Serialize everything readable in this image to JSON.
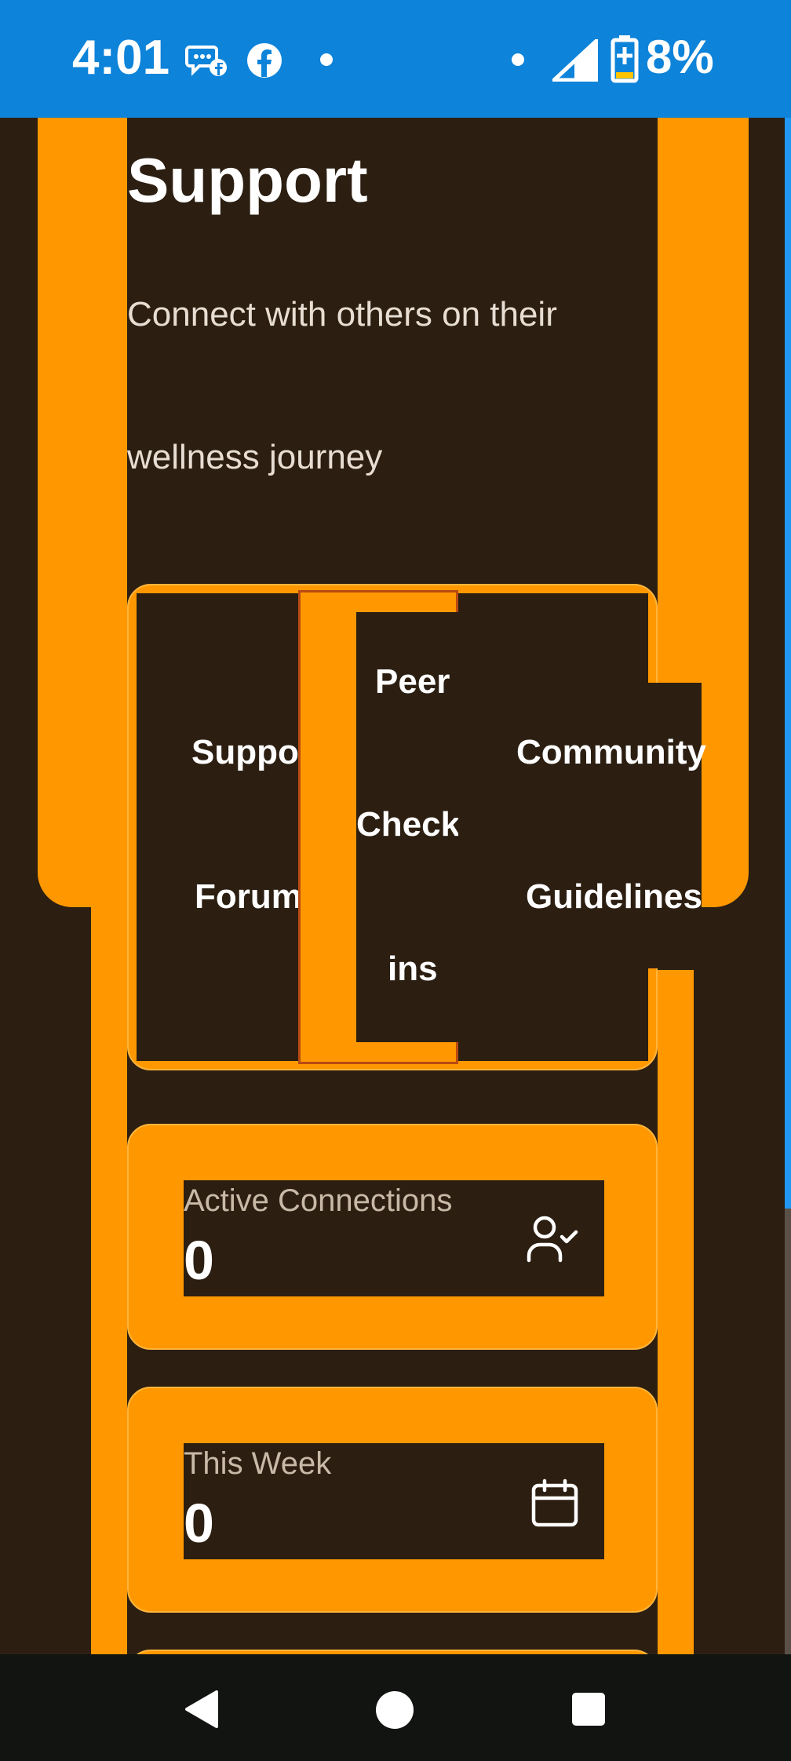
{
  "status_bar": {
    "time": "4:01",
    "battery": "8%",
    "icons": [
      "messenger-icon",
      "facebook-icon",
      "dot-icon",
      "signal-icon",
      "battery-charging-icon"
    ]
  },
  "header": {
    "title": "Support",
    "subtitle_line1": "Connect with others on their",
    "subtitle_line2": "wellness journey"
  },
  "tabs": {
    "support_forums": {
      "line1": "Suppor",
      "line2": "Forums"
    },
    "peer_checkins": {
      "line1": "Peer",
      "line2": "Check-",
      "line3": "ins"
    },
    "community_guidelines": {
      "line1": "Community",
      "line2": "Guidelines"
    }
  },
  "stats": [
    {
      "label": "Active Connections",
      "value": "0",
      "icon": "user-check-icon"
    },
    {
      "label": "This Week",
      "value": "0",
      "icon": "calendar-icon"
    }
  ],
  "nav": {
    "icons": [
      "back-icon",
      "home-icon",
      "recents-icon"
    ]
  },
  "colors": {
    "accent": "#ff9800",
    "background": "#2c1f12",
    "status_bar": "#0d83d9"
  }
}
